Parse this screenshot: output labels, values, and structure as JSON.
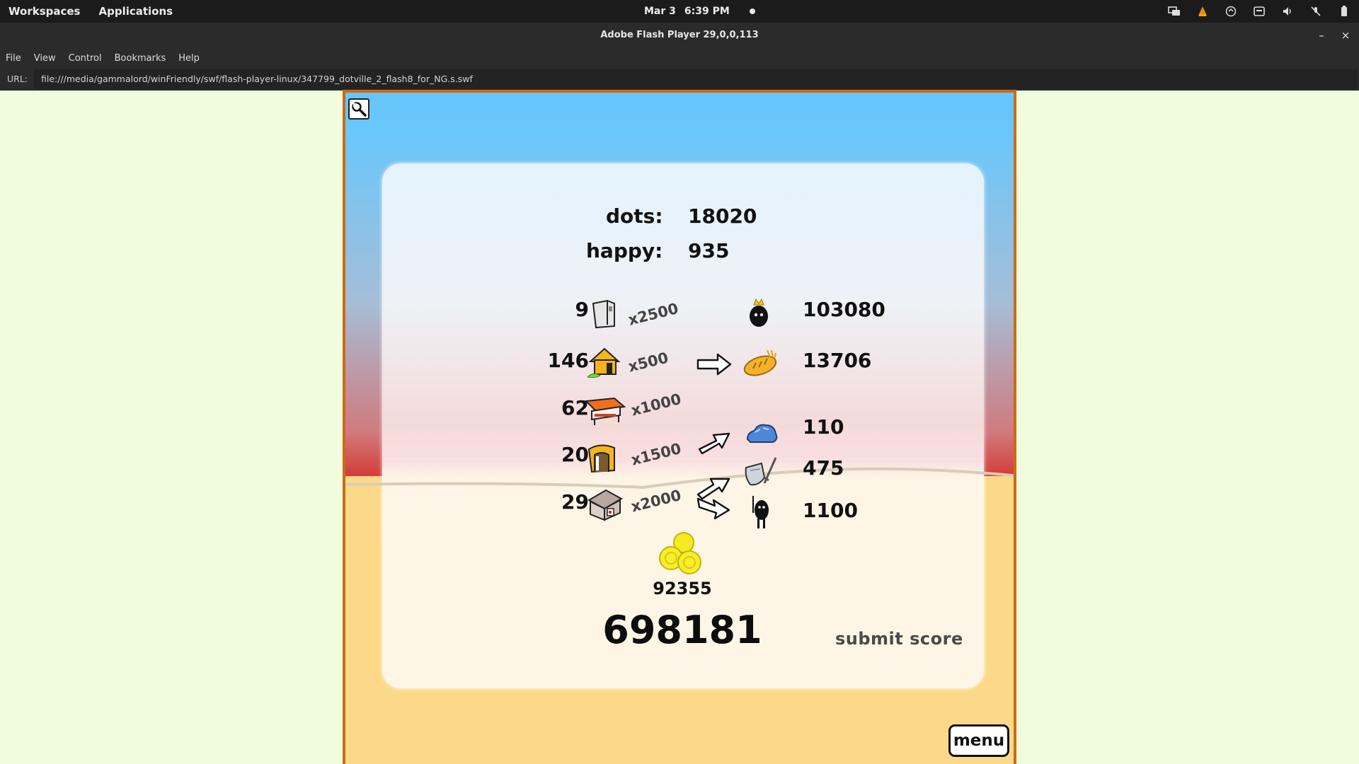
{
  "topbar": {
    "workspaces": "Workspaces",
    "applications": "Applications",
    "date": "Mar 3",
    "time": "6:39 PM"
  },
  "window": {
    "title": "Adobe Flash Player 29,0,0,113",
    "minimize": "–",
    "close": "×"
  },
  "menu": [
    "File",
    "View",
    "Control",
    "Bookmarks",
    "Help"
  ],
  "url": {
    "label": "URL:",
    "value": "file:///media/gammalord/winFriendly/swf/flash-player-linux/347799_dotville_2_flash8_for_NG.s.swf"
  },
  "game": {
    "dots_label": "dots:",
    "dots_value": "18020",
    "happy_label": "happy:",
    "happy_value": "935",
    "buildings": [
      {
        "count": "9",
        "mult": "x2500",
        "icon": "tower-icon"
      },
      {
        "count": "146",
        "mult": "x500",
        "icon": "house-icon"
      },
      {
        "count": "62",
        "mult": "x1000",
        "icon": "market-stall-icon"
      },
      {
        "count": "20",
        "mult": "x1500",
        "icon": "mine-icon"
      },
      {
        "count": "29",
        "mult": "x2000",
        "icon": "barracks-icon"
      }
    ],
    "results": [
      {
        "value": "103080",
        "icon": "king-icon"
      },
      {
        "value": "13706",
        "icon": "bread-icon"
      },
      {
        "value": "110",
        "icon": "ore-icon"
      },
      {
        "value": "475",
        "icon": "shield-sword-icon"
      },
      {
        "value": "1100",
        "icon": "soldier-icon"
      }
    ],
    "coins_value": "92355",
    "total_score": "698181",
    "submit_label": "submit score",
    "menu_label": "menu"
  }
}
